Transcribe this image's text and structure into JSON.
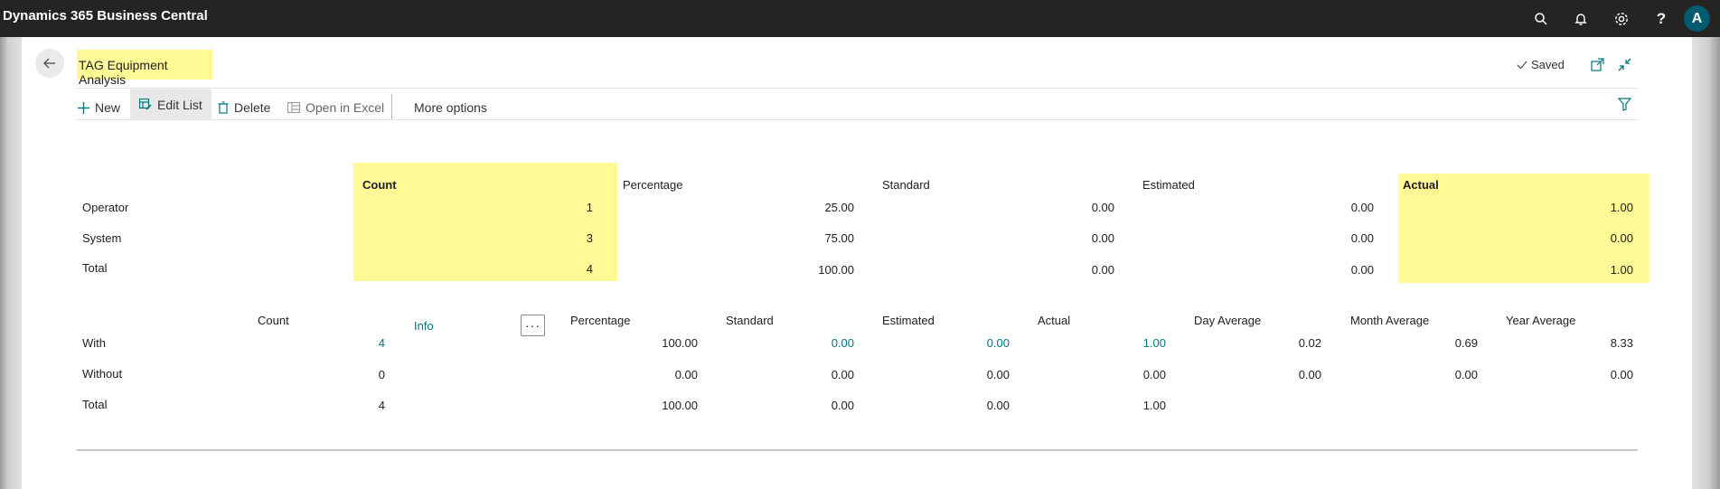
{
  "app": {
    "title": "Dynamics 365 Business Central",
    "avatar_initial": "A"
  },
  "page": {
    "title": "TAG Equipment Analysis",
    "saved_label": "Saved"
  },
  "actions": {
    "new": "New",
    "edit_list": "Edit List",
    "delete": "Delete",
    "open_in_excel": "Open in Excel",
    "more_options": "More options"
  },
  "table1": {
    "headers": {
      "count": "Count",
      "percentage": "Percentage",
      "standard": "Standard",
      "estimated": "Estimated",
      "actual": "Actual"
    },
    "rows": [
      {
        "label": "Operator",
        "count": "1",
        "percentage": "25.00",
        "standard": "0.00",
        "estimated": "0.00",
        "actual": "1.00"
      },
      {
        "label": "System",
        "count": "3",
        "percentage": "75.00",
        "standard": "0.00",
        "estimated": "0.00",
        "actual": "0.00"
      },
      {
        "label": "Total",
        "count": "4",
        "percentage": "100.00",
        "standard": "0.00",
        "estimated": "0.00",
        "actual": "1.00"
      }
    ]
  },
  "table2": {
    "headers": {
      "count": "Count",
      "info": "Info",
      "percentage": "Percentage",
      "standard": "Standard",
      "estimated": "Estimated",
      "actual": "Actual",
      "day_average": "Day Average",
      "month_average": "Month Average",
      "year_average": "Year Average"
    },
    "rows": [
      {
        "label": "With",
        "count": "4",
        "percentage": "100.00",
        "standard": "0.00",
        "estimated": "0.00",
        "actual": "1.00",
        "day_average": "0.02",
        "month_average": "0.69",
        "year_average": "8.33"
      },
      {
        "label": "Without",
        "count": "0",
        "percentage": "0.00",
        "standard": "0.00",
        "estimated": "0.00",
        "actual": "0.00",
        "day_average": "0.00",
        "month_average": "0.00",
        "year_average": "0.00"
      },
      {
        "label": "Total",
        "count": "4",
        "percentage": "100.00",
        "standard": "0.00",
        "estimated": "0.00",
        "actual": "1.00"
      }
    ]
  },
  "colors": {
    "highlight": "#fff996",
    "link": "#00777e",
    "appbar": "#252423",
    "avatar": "#005b70"
  }
}
